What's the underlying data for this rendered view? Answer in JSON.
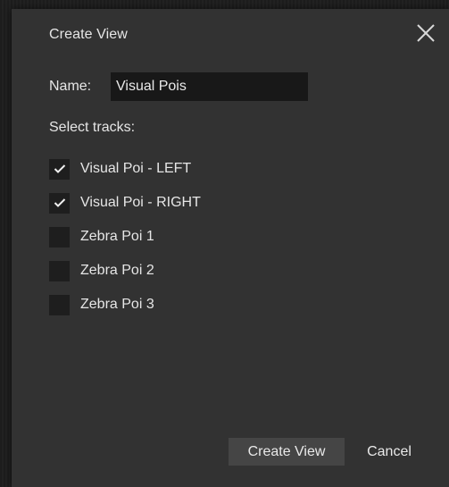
{
  "dialog": {
    "title": "Create View",
    "name_label": "Name:",
    "name_value": "Visual Pois",
    "select_label": "Select tracks:",
    "tracks": [
      {
        "label": "Visual Poi - LEFT",
        "checked": true
      },
      {
        "label": "Visual Poi - RIGHT",
        "checked": true
      },
      {
        "label": "Zebra Poi 1",
        "checked": false
      },
      {
        "label": "Zebra Poi 2",
        "checked": false
      },
      {
        "label": "Zebra Poi 3",
        "checked": false
      }
    ],
    "create_label": "Create View",
    "cancel_label": "Cancel",
    "close_icon": "close-icon"
  },
  "colors": {
    "dialog_bg": "#323232",
    "input_bg": "#181818",
    "checkbox_bg": "#1e1e1e",
    "primary_button_bg": "#454545",
    "text": "#e6e6e6"
  }
}
